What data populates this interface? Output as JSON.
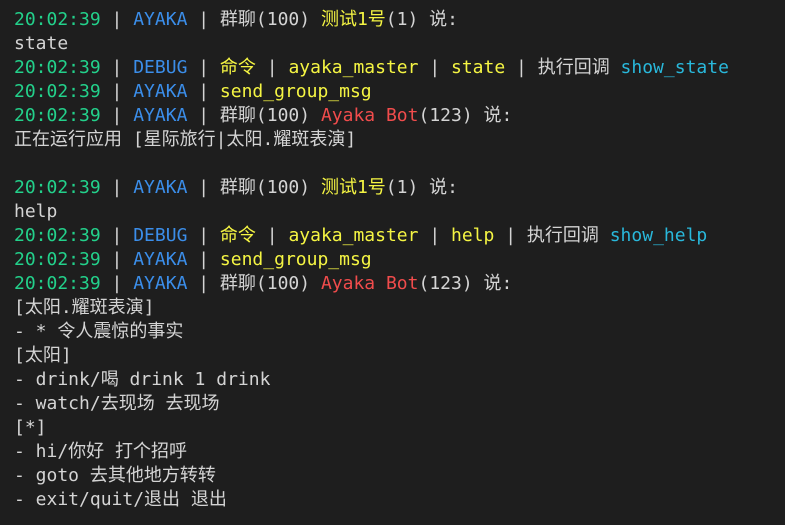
{
  "colors": {
    "background": "#1e1e1e",
    "timestamp": "#23d18b",
    "source": "#3b8eea",
    "command_highlight": "#f5f543",
    "bot_name": "#f14c4c",
    "function_name": "#29b8db",
    "default_text": "#d4d4d4"
  },
  "lines": [
    {
      "segments": [
        {
          "text": "20:02:39",
          "style": "ts"
        },
        {
          "text": " | ",
          "style": "sep"
        },
        {
          "text": "AYAKA",
          "style": "src-ayaka"
        },
        {
          "text": " | 群聊(100) ",
          "style": "plain"
        },
        {
          "text": "测试1号",
          "style": "sender-user"
        },
        {
          "text": "(1) 说:",
          "style": "plain"
        }
      ]
    },
    {
      "segments": [
        {
          "text": "state",
          "style": "plain"
        }
      ]
    },
    {
      "segments": [
        {
          "text": "20:02:39",
          "style": "ts"
        },
        {
          "text": " | ",
          "style": "sep"
        },
        {
          "text": "DEBUG",
          "style": "src-debug"
        },
        {
          "text": " | ",
          "style": "sep"
        },
        {
          "text": "命令",
          "style": "cmd"
        },
        {
          "text": " | ",
          "style": "sep"
        },
        {
          "text": "ayaka_master",
          "style": "cmd"
        },
        {
          "text": " | ",
          "style": "sep"
        },
        {
          "text": "state",
          "style": "cmd"
        },
        {
          "text": " | 执行回调 ",
          "style": "plain"
        },
        {
          "text": "show_state",
          "style": "func"
        }
      ]
    },
    {
      "segments": [
        {
          "text": "20:02:39",
          "style": "ts"
        },
        {
          "text": " | ",
          "style": "sep"
        },
        {
          "text": "AYAKA",
          "style": "src-ayaka"
        },
        {
          "text": " | ",
          "style": "sep"
        },
        {
          "text": "send_group_msg",
          "style": "cmd"
        }
      ]
    },
    {
      "segments": [
        {
          "text": "20:02:39",
          "style": "ts"
        },
        {
          "text": " | ",
          "style": "sep"
        },
        {
          "text": "AYAKA",
          "style": "src-ayaka"
        },
        {
          "text": " | 群聊(100) ",
          "style": "plain"
        },
        {
          "text": "Ayaka Bot",
          "style": "sender-bot"
        },
        {
          "text": "(123) 说:",
          "style": "plain"
        }
      ]
    },
    {
      "segments": [
        {
          "text": "正在运行应用 [星际旅行|太阳.耀斑表演]",
          "style": "plain"
        }
      ]
    },
    {
      "segments": []
    },
    {
      "segments": [
        {
          "text": "20:02:39",
          "style": "ts"
        },
        {
          "text": " | ",
          "style": "sep"
        },
        {
          "text": "AYAKA",
          "style": "src-ayaka"
        },
        {
          "text": " | 群聊(100) ",
          "style": "plain"
        },
        {
          "text": "测试1号",
          "style": "sender-user"
        },
        {
          "text": "(1) 说:",
          "style": "plain"
        }
      ]
    },
    {
      "segments": [
        {
          "text": "help",
          "style": "plain"
        }
      ]
    },
    {
      "segments": [
        {
          "text": "20:02:39",
          "style": "ts"
        },
        {
          "text": " | ",
          "style": "sep"
        },
        {
          "text": "DEBUG",
          "style": "src-debug"
        },
        {
          "text": " | ",
          "style": "sep"
        },
        {
          "text": "命令",
          "style": "cmd"
        },
        {
          "text": " | ",
          "style": "sep"
        },
        {
          "text": "ayaka_master",
          "style": "cmd"
        },
        {
          "text": " | ",
          "style": "sep"
        },
        {
          "text": "help",
          "style": "cmd"
        },
        {
          "text": " | 执行回调 ",
          "style": "plain"
        },
        {
          "text": "show_help",
          "style": "func"
        }
      ]
    },
    {
      "segments": [
        {
          "text": "20:02:39",
          "style": "ts"
        },
        {
          "text": " | ",
          "style": "sep"
        },
        {
          "text": "AYAKA",
          "style": "src-ayaka"
        },
        {
          "text": " | ",
          "style": "sep"
        },
        {
          "text": "send_group_msg",
          "style": "cmd"
        }
      ]
    },
    {
      "segments": [
        {
          "text": "20:02:39",
          "style": "ts"
        },
        {
          "text": " | ",
          "style": "sep"
        },
        {
          "text": "AYAKA",
          "style": "src-ayaka"
        },
        {
          "text": " | 群聊(100) ",
          "style": "plain"
        },
        {
          "text": "Ayaka Bot",
          "style": "sender-bot"
        },
        {
          "text": "(123) 说:",
          "style": "plain"
        }
      ]
    },
    {
      "segments": [
        {
          "text": "[太阳.耀斑表演]",
          "style": "plain"
        }
      ]
    },
    {
      "segments": [
        {
          "text": "- * 令人震惊的事实",
          "style": "plain"
        }
      ]
    },
    {
      "segments": [
        {
          "text": "[太阳]",
          "style": "plain"
        }
      ]
    },
    {
      "segments": [
        {
          "text": "- drink/喝 drink 1 drink",
          "style": "plain"
        }
      ]
    },
    {
      "segments": [
        {
          "text": "- watch/去现场 去现场",
          "style": "plain"
        }
      ]
    },
    {
      "segments": [
        {
          "text": "[*]",
          "style": "plain"
        }
      ]
    },
    {
      "segments": [
        {
          "text": "- hi/你好 打个招呼",
          "style": "plain"
        }
      ]
    },
    {
      "segments": [
        {
          "text": "- goto 去其他地方转转",
          "style": "plain"
        }
      ]
    },
    {
      "segments": [
        {
          "text": "- exit/quit/退出 退出",
          "style": "plain"
        }
      ]
    }
  ]
}
